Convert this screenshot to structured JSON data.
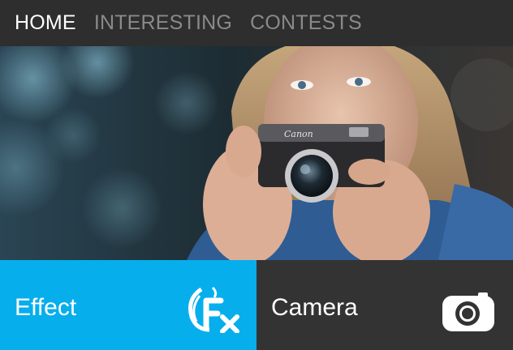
{
  "nav": {
    "tabs": [
      {
        "label": "HOME",
        "active": true
      },
      {
        "label": "INTERESTING",
        "active": false
      },
      {
        "label": "CONTESTS",
        "active": false
      }
    ]
  },
  "hero": {
    "camera_brand": "Canon"
  },
  "tiles": {
    "effect": {
      "label": "Effect",
      "icon": "fx-icon",
      "color": "#06aeec"
    },
    "camera": {
      "label": "Camera",
      "icon": "camera-icon",
      "color": "#333333"
    }
  }
}
